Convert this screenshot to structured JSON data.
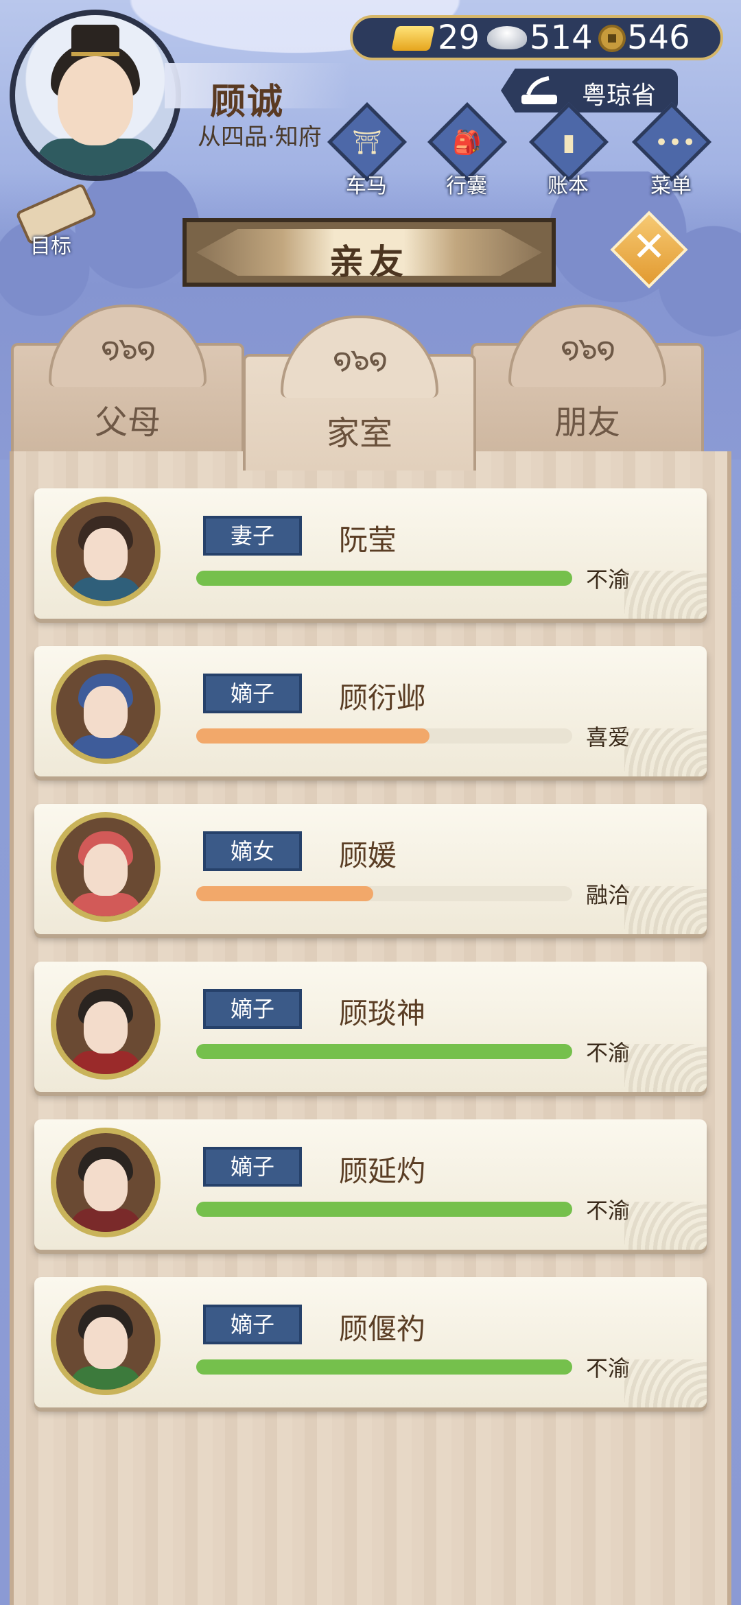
{
  "player": {
    "name": "顾诚",
    "rank": "从四品·知府"
  },
  "currency": {
    "gold": "29",
    "silver": "514",
    "copper": "546"
  },
  "province": "粤琼省",
  "nav": [
    {
      "label": "车马",
      "icon": "carriage-icon"
    },
    {
      "label": "行囊",
      "icon": "bag-icon"
    },
    {
      "label": "账本",
      "icon": "ledger-icon"
    },
    {
      "label": "菜单",
      "icon": "menu-dots-icon"
    }
  ],
  "goal_label": "目标",
  "title": "亲友",
  "tabs": [
    {
      "label": "父母",
      "active": false
    },
    {
      "label": "家室",
      "active": true
    },
    {
      "label": "朋友",
      "active": false
    }
  ],
  "members": [
    {
      "role": "妻子",
      "name": "阮莹",
      "mood": "不渝",
      "level": 1.0,
      "bar_color": "#75c04c",
      "hair": "#3a2a22",
      "clothes": "#2f5f7a"
    },
    {
      "role": "嫡子",
      "name": "顾衍邺",
      "mood": "喜爱",
      "level": 0.62,
      "bar_color": "#f2a86a",
      "hair": "#3e5c9a",
      "clothes": "#3e5c9a"
    },
    {
      "role": "嫡女",
      "name": "顾媛",
      "mood": "融洽",
      "level": 0.47,
      "bar_color": "#f2a86a",
      "hair": "#d25a58",
      "clothes": "#d25a58"
    },
    {
      "role": "嫡子",
      "name": "顾琰神",
      "mood": "不渝",
      "level": 1.0,
      "bar_color": "#75c04c",
      "hair": "#2a2420",
      "clothes": "#9a2a2a"
    },
    {
      "role": "嫡子",
      "name": "顾延灼",
      "mood": "不渝",
      "level": 1.0,
      "bar_color": "#75c04c",
      "hair": "#2a2420",
      "clothes": "#7a2a2a"
    },
    {
      "role": "嫡子",
      "name": "顾偃礿",
      "mood": "不渝",
      "level": 1.0,
      "bar_color": "#75c04c",
      "hair": "#2a2420",
      "clothes": "#3c7a3c"
    }
  ]
}
